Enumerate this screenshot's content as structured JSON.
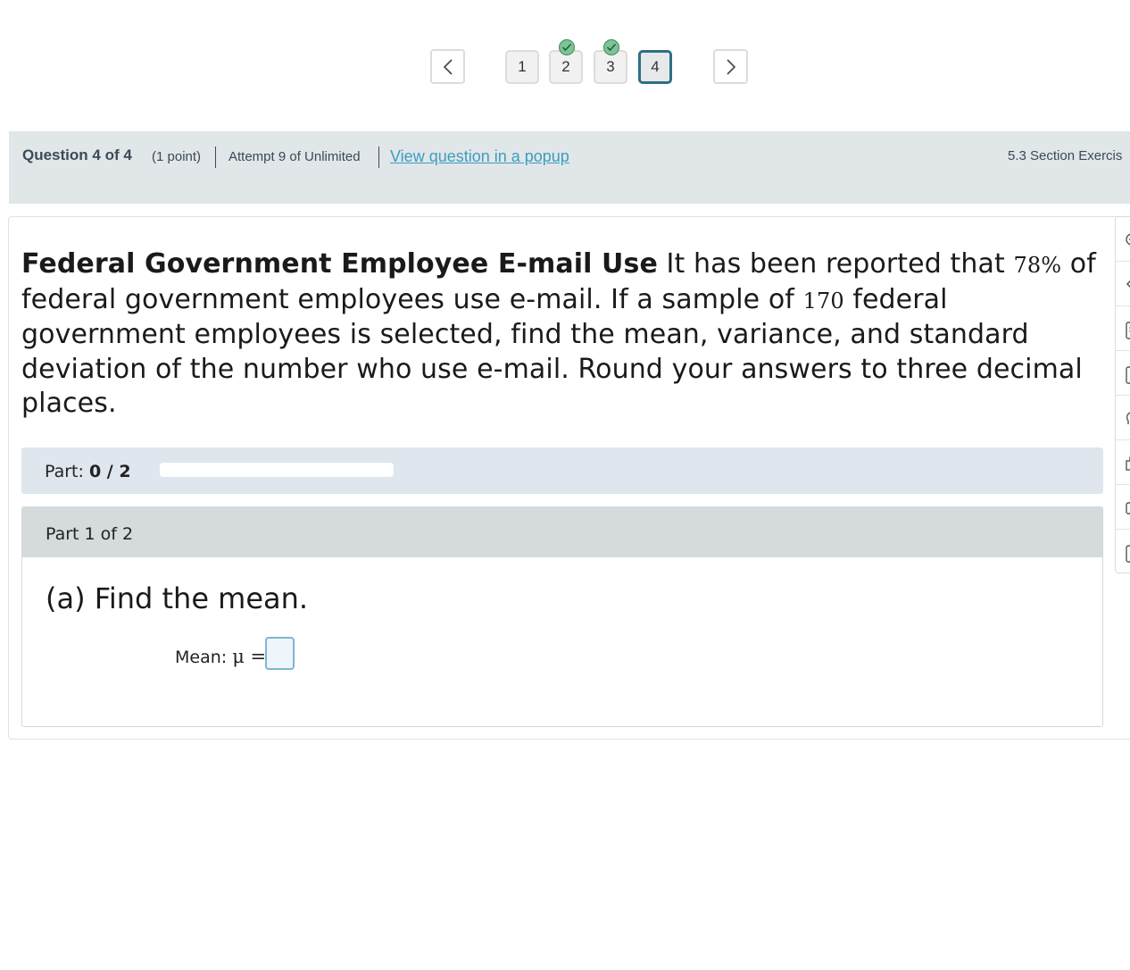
{
  "nav": {
    "prev_icon": "chevron-left-icon",
    "next_icon": "chevron-right-icon",
    "questions": [
      {
        "label": "1",
        "completed": false,
        "current": false
      },
      {
        "label": "2",
        "completed": true,
        "current": false
      },
      {
        "label": "3",
        "completed": true,
        "current": false
      },
      {
        "label": "4",
        "completed": false,
        "current": true
      }
    ],
    "completed_color": "#7cc497",
    "current_border_color": "#2f6f84"
  },
  "header": {
    "title": "Question 4 of 4",
    "points": "(1 point)",
    "attempt": "Attempt 9 of Unlimited",
    "popup_link": "View question in a popup",
    "assignment": "5.3 Section Exercis"
  },
  "problem": {
    "title": "Federal Government Employee E-mail Use",
    "text_1": " It has been reported that ",
    "percent": "78%",
    "text_2": " of federal government employees use e-mail. If a sample of ",
    "sample_size": "170",
    "text_3": " federal government employees is selected, find the mean, variance, and standard deviation of the number who use e-mail. Round your answers to three decimal places."
  },
  "part_progress": {
    "label": "Part: ",
    "value": "0 / 2",
    "fraction": 0
  },
  "part": {
    "title": "Part 1 of 2",
    "question": "(a) Find the mean.",
    "answer_label": "Mean: ",
    "symbol": "μ =",
    "answer_value": ""
  },
  "tools": [
    "tool-1-icon",
    "tool-2-icon",
    "tool-3-icon",
    "tool-4-icon",
    "tool-5-icon",
    "tool-6-icon",
    "tool-7-icon",
    "tool-8-icon"
  ]
}
